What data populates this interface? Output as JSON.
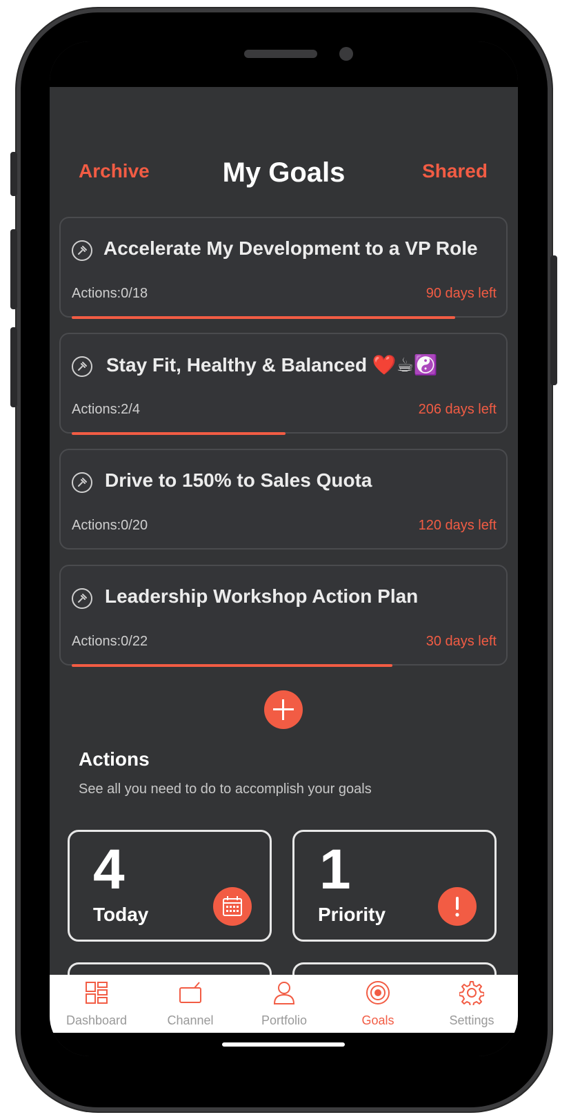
{
  "header": {
    "title": "My Goals",
    "left_link": "Archive",
    "right_link": "Shared"
  },
  "goals": [
    {
      "title": "Accelerate My Development to a VP Role",
      "actions": "Actions:0/18",
      "days_left": "90 days left",
      "progress": 0.86
    },
    {
      "title": "Stay Fit, Healthy & Balanced ❤️☕☯️",
      "actions": "Actions:2/4",
      "days_left": "206 days left",
      "progress": 0.48
    },
    {
      "title": "Drive to 150% to Sales Quota",
      "actions": "Actions:0/20",
      "days_left": "120 days left",
      "progress": 0
    },
    {
      "title": "Leadership Workshop Action Plan",
      "actions": "Actions:0/22",
      "days_left": "30 days left",
      "progress": 0.72
    }
  ],
  "actions_section": {
    "title": "Actions",
    "subtitle": "See all you need to do to accomplish your goals",
    "tiles": [
      {
        "count": "4",
        "label": "Today",
        "icon": "calendar-icon"
      },
      {
        "count": "1",
        "label": "Priority",
        "icon": "exclamation-icon"
      }
    ]
  },
  "tabbar": {
    "items": [
      {
        "label": "Dashboard",
        "icon": "dashboard-icon"
      },
      {
        "label": "Channel",
        "icon": "tv-icon"
      },
      {
        "label": "Portfolio",
        "icon": "person-icon"
      },
      {
        "label": "Goals",
        "icon": "target-icon",
        "active": true
      },
      {
        "label": "Settings",
        "icon": "gear-icon"
      }
    ]
  },
  "colors": {
    "accent": "#f25c44",
    "background": "#333436",
    "card": "#343538"
  }
}
